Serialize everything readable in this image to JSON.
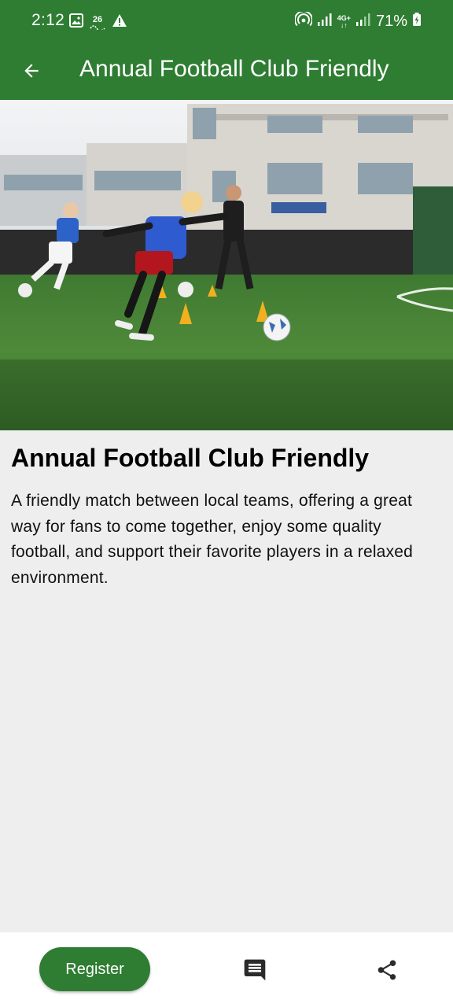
{
  "status_bar": {
    "time": "2:12",
    "notification_count": "26",
    "battery": "71%",
    "icons": [
      "image-icon",
      "data-usage-icon",
      "warning-icon",
      "hotspot-icon",
      "signal-icon",
      "4g-icon",
      "signal-weak-icon",
      "battery-charging-icon"
    ]
  },
  "app_bar": {
    "title": "Annual Football Club Friendly",
    "back_icon": "arrow-back-icon",
    "color": "#2e7d32"
  },
  "event": {
    "image_icon": "football-training-photo",
    "title": "Annual Football Club Friendly",
    "description": "A friendly match between local teams, offering a great way for fans to come together, enjoy some quality football, and support their favorite players in a relaxed environment."
  },
  "bottom_bar": {
    "register_label": "Register",
    "comment_icon": "comment-icon",
    "share_icon": "share-icon",
    "accent": "#2e7d32"
  }
}
